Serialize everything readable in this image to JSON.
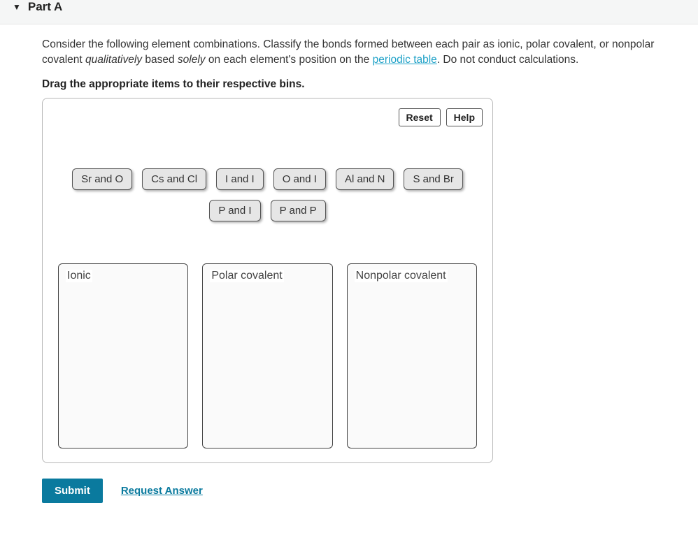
{
  "header": {
    "part_label": "Part A"
  },
  "question": {
    "text_pre": "Consider the following element combinations. Classify the bonds formed between each pair as ionic, polar covalent, or nonpolar covalent ",
    "em1": "qualitatively",
    "text_mid1": " based ",
    "em2": "solely",
    "text_mid2": " on each element's position on the ",
    "link_text": "periodic table",
    "text_post": ". Do not conduct calculations."
  },
  "instruction": "Drag the appropriate items to their respective bins.",
  "toolbar": {
    "reset": "Reset",
    "help": "Help"
  },
  "items": [
    "Sr and O",
    "Cs and Cl",
    "I and I",
    "O and I",
    "Al and N",
    "S and Br",
    "P and I",
    "P and P"
  ],
  "bins": [
    "Ionic",
    "Polar covalent",
    "Nonpolar covalent"
  ],
  "actions": {
    "submit": "Submit",
    "request": "Request Answer"
  }
}
